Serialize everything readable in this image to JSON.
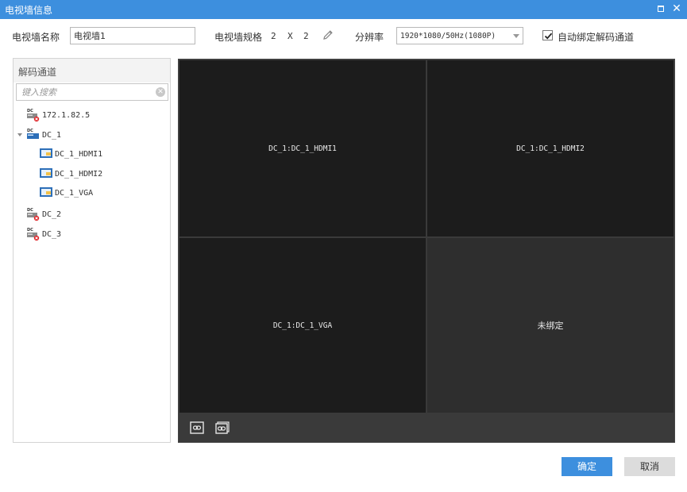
{
  "window": {
    "title": "电视墙信息"
  },
  "form": {
    "name_label": "电视墙名称",
    "name_value": "电视墙1",
    "spec_label": "电视墙规格",
    "rows": "2",
    "x_sep": "X",
    "cols": "2",
    "resolution_label": "分辨率",
    "resolution_value": "1920*1080/50Hz(1080P)",
    "auto_bind_label": "自动绑定解码通道",
    "auto_bind_checked": true
  },
  "panel": {
    "title": "解码通道",
    "search_placeholder": "键入搜索",
    "device_badge": "DC",
    "tree": [
      {
        "label": "172.1.82.5",
        "kind": "device",
        "status": "offline"
      },
      {
        "label": "DC_1",
        "kind": "device",
        "status": "online",
        "expanded": true
      },
      {
        "label": "DC_1_HDMI1",
        "kind": "channel"
      },
      {
        "label": "DC_1_HDMI2",
        "kind": "channel"
      },
      {
        "label": "DC_1_VGA",
        "kind": "channel"
      },
      {
        "label": "DC_2",
        "kind": "device",
        "status": "offline"
      },
      {
        "label": "DC_3",
        "kind": "device",
        "status": "offline"
      }
    ]
  },
  "wall": {
    "cells": [
      {
        "label": "DC_1:DC_1_HDMI1"
      },
      {
        "label": "DC_1:DC_1_HDMI2"
      },
      {
        "label": "DC_1:DC_1_VGA"
      },
      {
        "label": "未绑定"
      }
    ]
  },
  "buttons": {
    "ok": "确定",
    "cancel": "取消"
  },
  "colors": {
    "accent": "#3d8fde",
    "offline": "#e0262a",
    "wall_bg": "#1c1c1c"
  }
}
